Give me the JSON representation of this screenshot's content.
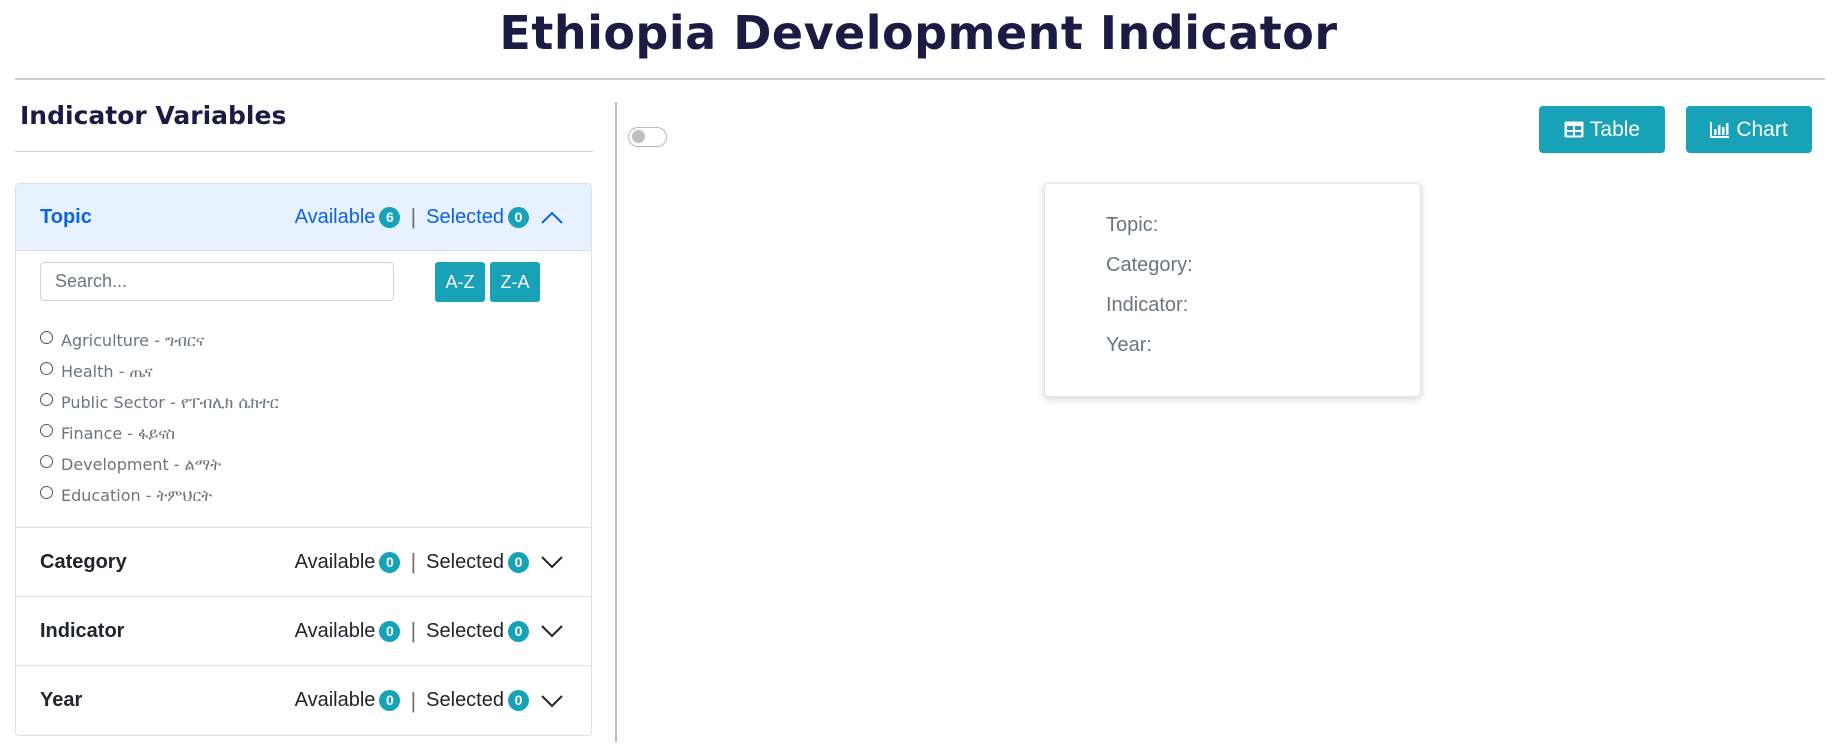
{
  "header": {
    "title": "Ethiopia Development Indicator"
  },
  "sidebar": {
    "title": "Indicator Variables",
    "sections": [
      {
        "name": "Topic",
        "available_label": "Available",
        "available": "6",
        "separator": "|",
        "selected_label": "Selected",
        "selected": "0",
        "expanded": true
      },
      {
        "name": "Category",
        "available_label": "Available",
        "available": "0",
        "separator": "|",
        "selected_label": "Selected",
        "selected": "0",
        "expanded": false
      },
      {
        "name": "Indicator",
        "available_label": "Available",
        "available": "0",
        "separator": "|",
        "selected_label": "Selected",
        "selected": "0",
        "expanded": false
      },
      {
        "name": "Year",
        "available_label": "Available",
        "available": "0",
        "separator": "|",
        "selected_label": "Selected",
        "selected": "0",
        "expanded": false
      }
    ],
    "topic_panel": {
      "search_placeholder": "Search...",
      "sort_az": "A-Z",
      "sort_za": "Z-A",
      "options": [
        "Agriculture - ግብርና",
        "Health - ጤና",
        "Public Sector - የፐብሊክ ሴክተር",
        "Finance - ፋይናስ",
        "Development - ልማት",
        "Education - ትምህርት"
      ]
    }
  },
  "toolbar": {
    "table_label": "Table",
    "chart_label": "Chart",
    "toggle_on": false
  },
  "info_card": {
    "topic_label": "Topic:",
    "category_label": "Category:",
    "indicator_label": "Indicator:",
    "year_label": "Year:"
  },
  "colors": {
    "accent": "#17a2b8",
    "title": "#1d1a43",
    "open_header_bg": "#e7f1ff",
    "open_header_text": "#0c63e4"
  },
  "icons": {
    "expanded": "chevron-up-icon",
    "collapsed": "chevron-down-icon",
    "table": "table-icon",
    "chart": "bar-chart-icon"
  }
}
